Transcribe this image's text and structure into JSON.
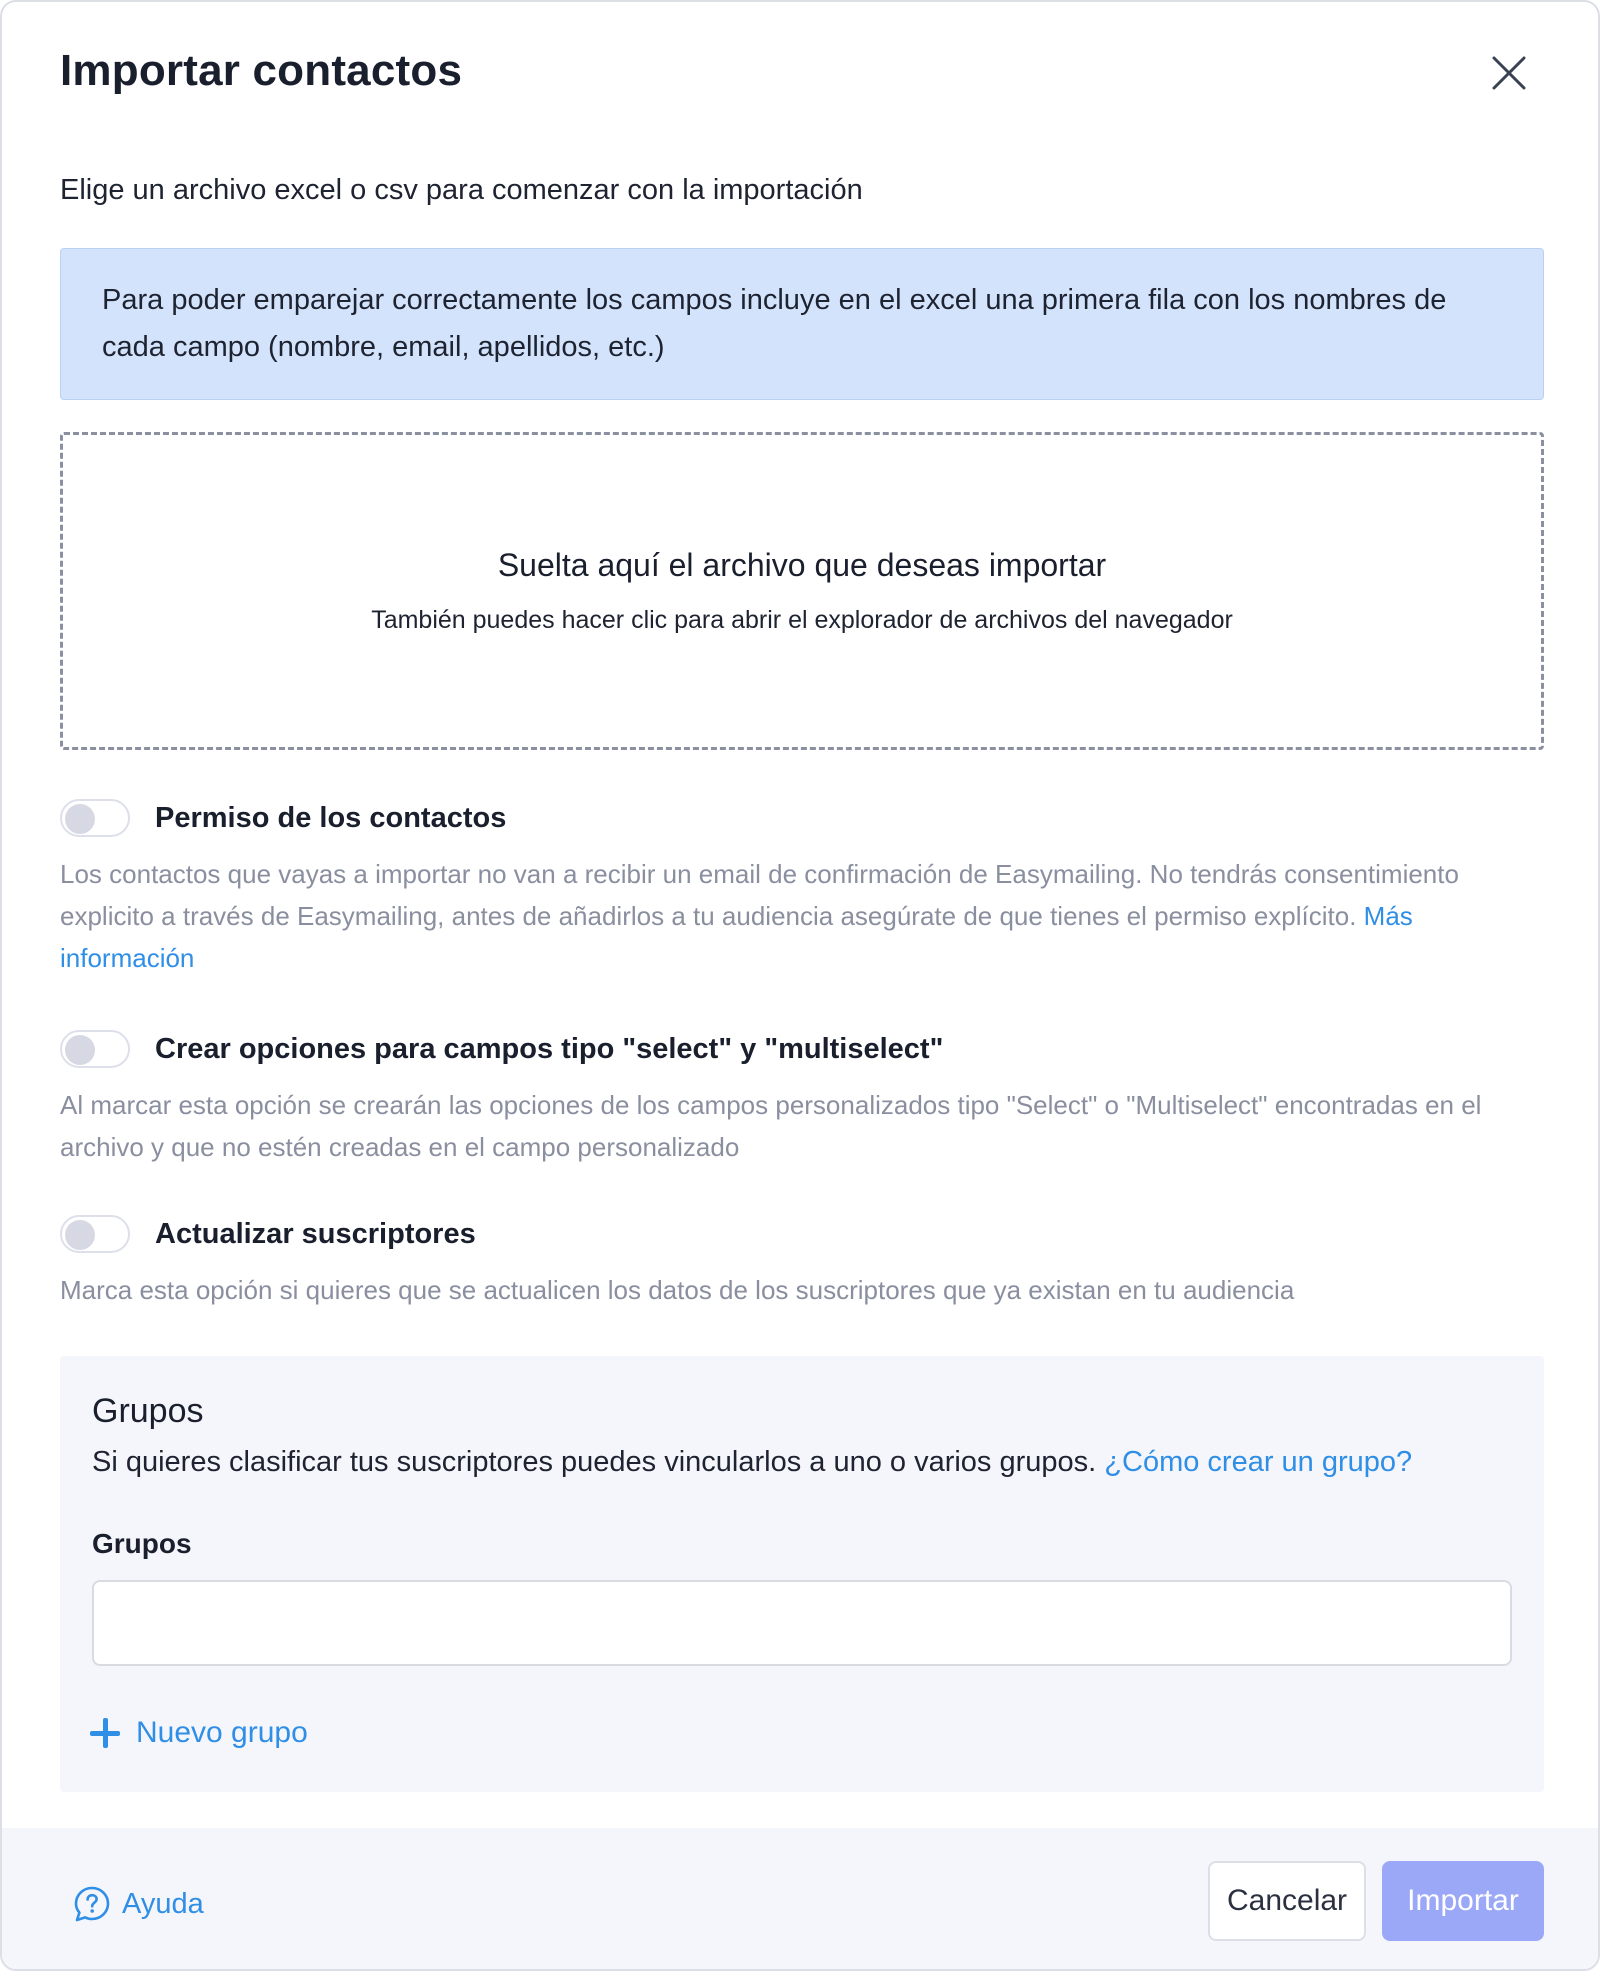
{
  "modal": {
    "title": "Importar contactos",
    "close_icon": "close-icon"
  },
  "intro_text": "Elige un archivo excel o csv para comenzar con la importación",
  "info_box": {
    "text": "Para poder emparejar correctamente los campos incluye en el excel una primera fila con los nombres de cada campo (nombre, email, apellidos, etc.)"
  },
  "dropzone": {
    "title": "Suelta aquí el archivo que deseas importar",
    "subtitle": "También puedes hacer clic para abrir el explorador de archivos del navegador"
  },
  "options": [
    {
      "label": "Permiso de los contactos",
      "enabled": false,
      "description": "Los contactos que vayas a importar no van a recibir un email de confirmación de Easymailing. No tendrás consentimiento explicito a través de Easymailing, antes de añadirlos a tu audiencia asegúrate de que tienes el permiso explícito.",
      "link": "Más información"
    },
    {
      "label": "Crear opciones para campos tipo \"select\" y \"multiselect\"",
      "enabled": false,
      "description": "Al marcar esta opción se crearán las opciones de los campos personalizados tipo \"Select\" o \"Multiselect\" encontradas en el archivo y que no estén creadas en el campo personalizado"
    },
    {
      "label": "Actualizar suscriptores",
      "enabled": false,
      "description": "Marca esta opción si quieres que se actualicen los datos de los suscriptores que ya existan en tu audiencia"
    }
  ],
  "groups": {
    "title": "Grupos",
    "description": "Si quieres clasificar tus suscriptores puedes vincularlos a uno o varios grupos.",
    "help_link": "¿Cómo crear un grupo?",
    "field_label": "Grupos",
    "field_value": "",
    "new_group_label": "Nuevo grupo",
    "new_group_icon": "plus-icon"
  },
  "footer": {
    "help_label": "Ayuda",
    "help_icon": "help-bubble-icon",
    "cancel_label": "Cancelar",
    "import_label": "Importar"
  },
  "colors": {
    "accent": "#2f8ee6",
    "info_bg": "#d3e3fb",
    "import_button_disabled": "#9ba8f7",
    "panel_bg": "#f5f6fb",
    "muted_text": "#8a8fa0"
  }
}
